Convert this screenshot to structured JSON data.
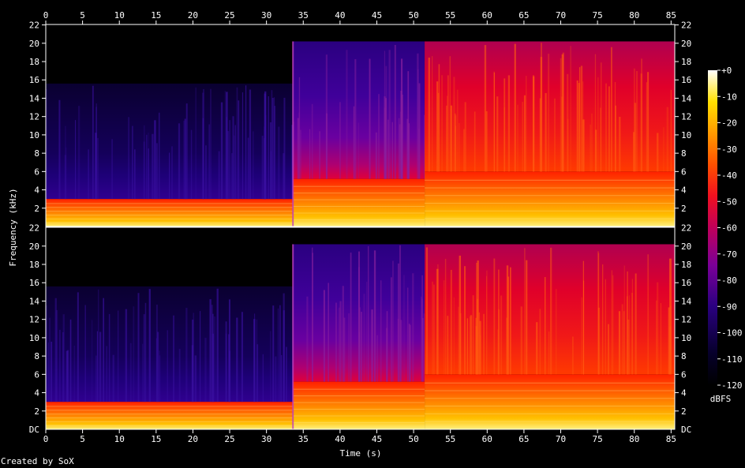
{
  "chart_data": {
    "type": "heatmap",
    "title": "",
    "xlabel": "Time (s)",
    "ylabel": "Frequency (kHz)",
    "xlim": [
      0,
      85.5
    ],
    "ylim": [
      0,
      22.05
    ],
    "x_ticks": [
      "0",
      "5",
      "10",
      "15",
      "20",
      "25",
      "30",
      "35",
      "40",
      "45",
      "50",
      "55",
      "60",
      "65",
      "70",
      "75",
      "80",
      "85"
    ],
    "y_ticks": [
      "22",
      "20",
      "18",
      "16",
      "14",
      "12",
      "10",
      "8",
      "6",
      "4",
      "2"
    ],
    "y_tick_bottom": "DC",
    "channels": 2,
    "colorbar": {
      "label": "dBFS",
      "ticks": [
        "+0",
        "-10",
        "-20",
        "-30",
        "-40",
        "-50",
        "-60",
        "-70",
        "-80",
        "-90",
        "-100",
        "-110",
        "-120"
      ],
      "range": [
        -120,
        0
      ]
    },
    "segments": [
      {
        "start_s": 0,
        "end_s": 33.6,
        "bandwidth_khz": 15.6,
        "low_band_khz": 3.0,
        "description_level_dbfs": -100
      },
      {
        "start_s": 33.6,
        "end_s": 51.5,
        "bandwidth_khz": 20.2,
        "low_band_khz": 5.2,
        "description_level_dbfs": -80
      },
      {
        "start_s": 51.5,
        "end_s": 85.5,
        "bandwidth_khz": 20.2,
        "low_band_khz": 6.0,
        "description_level_dbfs": -55
      }
    ],
    "credit": "Created by SoX"
  }
}
